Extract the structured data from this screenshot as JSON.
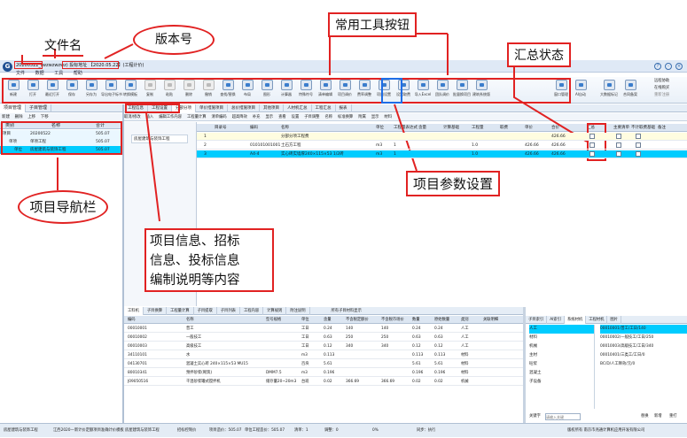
{
  "annotations": {
    "filename": "文件名",
    "version": "版本号",
    "toolbar": "常用工具按钮",
    "summary_status": "汇总状态",
    "project_settings": "项目参数设置",
    "project_nav": "项目导航栏",
    "project_info": "项目信息、招标\n信息、投标信息\n编制说明等内容"
  },
  "window": {
    "title": "20200522_(wzwzwzwz) 投标地址 【2020.05.22】(工程计价)",
    "menu": [
      "文件",
      "数据",
      "工具",
      "帮助"
    ]
  },
  "ribbon": {
    "buttons": [
      "新建",
      "打开",
      "最近打开",
      "保存",
      "另存为",
      "导出电子标书",
      "转换模板",
      "复制",
      "粘贴",
      "删除",
      "撤销",
      "查找/替换",
      "布局",
      "图形",
      "计算器",
      "特殊符号",
      "清单编辑",
      "项目调价",
      "费率调整",
      "项目设置",
      "设置取费",
      "导入Excel",
      "团队调价",
      "批量换项目",
      "建筑系统版",
      "窗口管理",
      "AI自动",
      "大数据标记",
      "合同备案"
    ],
    "right_items": [
      "远程协助",
      "在线购买",
      "重新注册"
    ]
  },
  "nav": {
    "tabs": [
      "项目管理",
      "子目管理"
    ],
    "toolbar": [
      "新建",
      "删除",
      "上移",
      "下移"
    ],
    "headers": [
      "类别",
      "名称",
      "合计"
    ],
    "rows": [
      {
        "type": "项目",
        "name": "20200522",
        "total": "505.07"
      },
      {
        "type": "单项",
        "name": "单项工程",
        "total": "505.07"
      },
      {
        "type": "单位",
        "name": "房屋建筑与装饰工程",
        "total": "505.07"
      }
    ]
  },
  "main": {
    "tabs": [
      "工程信息",
      "工程设置",
      "分部分项",
      "单价措施项目",
      "总价措施项目",
      "其他项目",
      "人材机汇总",
      "工程汇总",
      "报表"
    ],
    "toolbar": [
      "取消/修改",
      "插入",
      "编辑工作内容",
      "工程量计算",
      "清单编码",
      "超高降效",
      "补充",
      "显示",
      "查看",
      "设置",
      "子目调整",
      "名称",
      "标准换算",
      "附属",
      "显示",
      "材料"
    ],
    "side_tree": [
      "房屋建筑与装饰工程"
    ],
    "headers": [
      "",
      "目录号",
      "编码",
      "名称",
      "单位",
      "工程量表达式",
      "含量",
      "计算基础",
      "工程量",
      "取费",
      "单价",
      "合价",
      "汇总",
      "主要清单",
      "不计取费基础",
      "备注"
    ],
    "rows": [
      {
        "no": "1",
        "code": "",
        "name": "分部分项工程费",
        "unit": "",
        "expr": "",
        "qty": "",
        "price": "",
        "total": "426.66"
      },
      {
        "no": "2",
        "code": "010101001001",
        "name": "土石方工程",
        "unit": "m3",
        "expr": "1",
        "qty": "1.0",
        "price": "426.66",
        "total": "426.66"
      },
      {
        "no": "3",
        "code": "A4-4",
        "name": "实心砖实墙厚240×115×53 1/2砖",
        "unit": "m3",
        "expr": "1",
        "qty": "1.0",
        "price": "426.66",
        "total": "426.66"
      }
    ]
  },
  "bottom": {
    "tabs": [
      "工料机",
      "子目换算",
      "工程量计算",
      "子目提取",
      "子目列表",
      "工程内容",
      "计算规则",
      "附注说明"
    ],
    "extra": "所有子目材料显示",
    "headers": [
      "编码",
      "名称",
      "型号规格",
      "单位",
      "含量",
      "不含税定额价",
      "不含税市场价",
      "数量",
      "原始数量",
      "类别",
      "关联明细"
    ],
    "rows": [
      {
        "code": "00010001",
        "name": "普工",
        "spec": "",
        "unit": "工日",
        "qty": "0.24",
        "p1": "140",
        "p2": "140",
        "num": "0.24",
        "orig": "0.24",
        "cat": "人工"
      },
      {
        "code": "00010002",
        "name": "一般技工",
        "spec": "",
        "unit": "工日",
        "qty": "0.63",
        "p1": "250",
        "p2": "250",
        "num": "0.63",
        "orig": "0.63",
        "cat": "人工"
      },
      {
        "code": "00010003",
        "name": "高级技工",
        "spec": "",
        "unit": "工日",
        "qty": "0.12",
        "p1": "340",
        "p2": "340",
        "num": "0.12",
        "orig": "0.12",
        "cat": "人工"
      },
      {
        "code": "34110101",
        "name": "水",
        "spec": "",
        "unit": "m3",
        "qty": "0.113",
        "p1": "",
        "p2": "",
        "num": "0.113",
        "orig": "0.113",
        "cat": "材料"
      },
      {
        "code": "04130701",
        "name": "混凝土实心砖 240×115×53 MU15",
        "spec": "",
        "unit": "百块",
        "qty": "5.61",
        "p1": "",
        "p2": "",
        "num": "5.61",
        "orig": "5.61",
        "cat": "材料"
      },
      {
        "code": "80010341",
        "name": "预拌砂浆(砌筑)",
        "spec": "DMM7.5",
        "unit": "m3",
        "qty": "0.196",
        "p1": "",
        "p2": "",
        "num": "0.196",
        "orig": "0.196",
        "cat": "材料"
      },
      {
        "code": "J09050516",
        "name": "干混砂浆罐式搅拌机",
        "spec": "储存量20~20m3",
        "unit": "台班",
        "qty": "0.02",
        "p1": "366.69",
        "p2": "366.69",
        "num": "0.02",
        "orig": "0.02",
        "cat": "机械"
      }
    ]
  },
  "right_panel": {
    "tabs": [
      "子目索引",
      "AI索引",
      "系统材机",
      "工程材机",
      "图片"
    ],
    "tree": [
      "人工",
      "材料",
      "机械",
      "主材",
      "砼浆",
      "混凝土",
      "子设备"
    ],
    "list": [
      "00010001/普工/工日/140",
      "00010002/一般技工/工日/250",
      "00010003/高级技工/工日/340",
      "00010401/三类工/工日/0",
      "BC/D/人工降效/元/0"
    ],
    "search_label": "关键字",
    "search_placeholder": "请输入关键",
    "actions": [
      "替换",
      "新增",
      "重打"
    ]
  },
  "status": {
    "items": [
      "房屋建筑与装饰工程",
      "江西2020—新计价定额项目准确计价模板 房屋建筑与装饰工程",
      "招标控制价",
      "项目造价：505.07",
      "单位工程造价：505.07",
      "清单：1",
      "调整：0",
      "0%",
      "同步：执行"
    ],
    "right": "版权所有 南京市兆通计算机应用开发有限公司"
  },
  "colors": {
    "accent": "#1e6de6",
    "annotation": "#e12222",
    "selected_row": "#00ccff"
  }
}
